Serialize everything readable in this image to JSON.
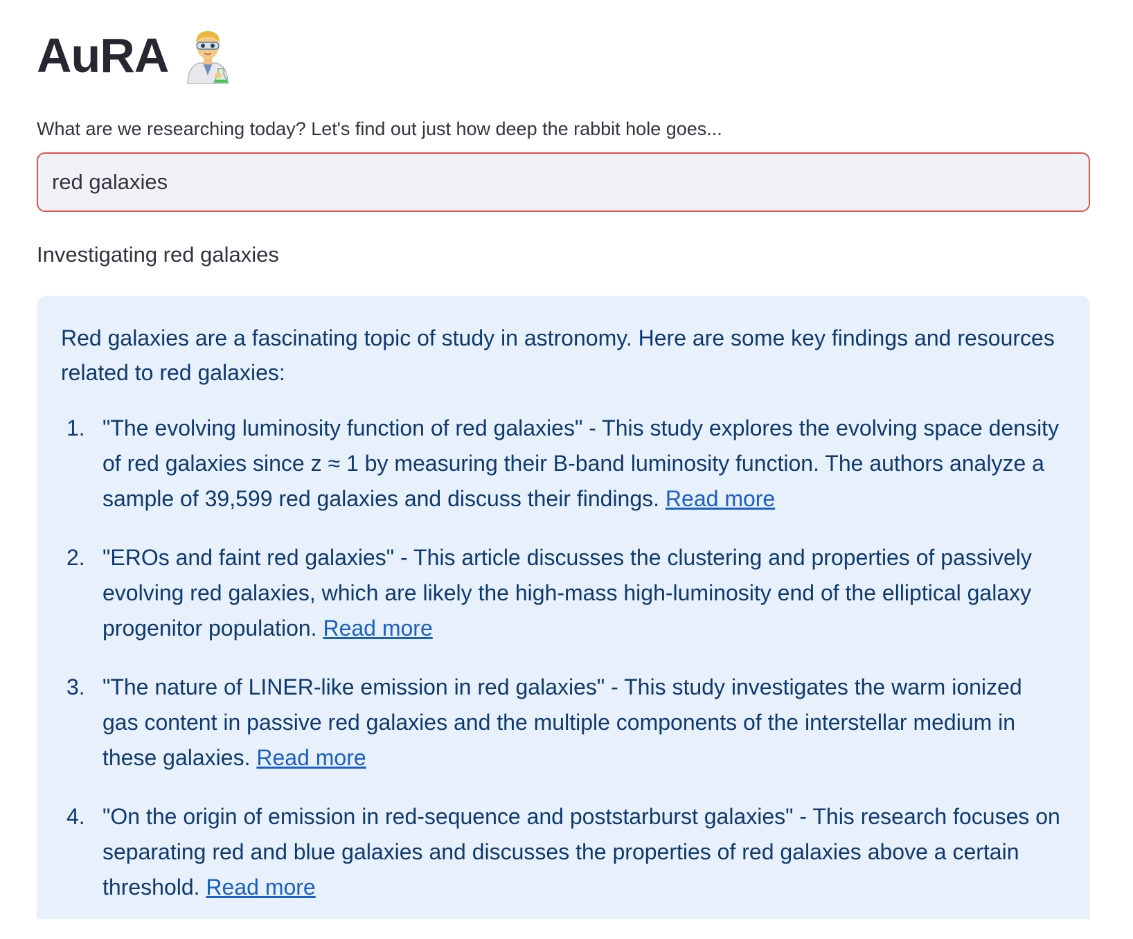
{
  "app": {
    "title": "AuRA",
    "title_icon": "scientist-emoji-icon"
  },
  "prompt": {
    "label": "What are we researching today? Let's find out just how deep the rabbit hole goes...",
    "value": "red galaxies"
  },
  "status": {
    "text": "Investigating red galaxies"
  },
  "result": {
    "intro": "Red galaxies are a fascinating topic of study in astronomy. Here are some key findings and resources related to red galaxies:",
    "items": [
      {
        "number": "1.",
        "text": "\"The evolving luminosity function of red galaxies\" - This study explores the evolving space density of red galaxies since z ≈ 1 by measuring their B-band luminosity function. The authors analyze a sample of 39,599 red galaxies and discuss their findings.",
        "link": "Read more"
      },
      {
        "number": "2.",
        "text": "\"EROs and faint red galaxies\" - This article discusses the clustering and properties of passively evolving red galaxies, which are likely the high-mass high-luminosity end of the elliptical galaxy progenitor population.",
        "link": "Read more"
      },
      {
        "number": "3.",
        "text": "\"The nature of LINER-like emission in red galaxies\" - This study investigates the warm ionized gas content in passive red galaxies and the multiple components of the interstellar medium in these galaxies.",
        "link": "Read more"
      },
      {
        "number": "4.",
        "text": "\"On the origin of emission in red-sequence and poststarburst galaxies\" - This research focuses on separating red and blue galaxies and discusses the properties of red galaxies above a certain threshold.",
        "link": "Read more"
      }
    ]
  },
  "colors": {
    "input_border": "#e0514e",
    "input_bg": "#f0f2f6",
    "panel_bg": "#e8f0fb",
    "panel_text": "#0e3a6e",
    "link": "#1a5fc7"
  }
}
